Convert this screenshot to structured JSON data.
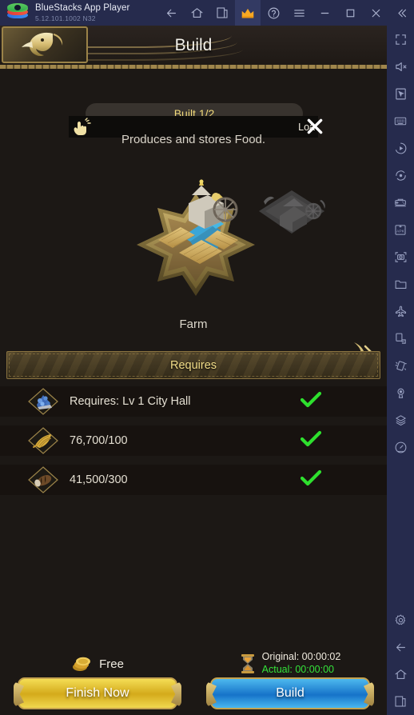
{
  "titlebar": {
    "app_name": "BlueStacks App Player",
    "version": "5.12.101.1002  N32",
    "buttons": [
      {
        "name": "back",
        "icon": "back-arrow-icon"
      },
      {
        "name": "home",
        "icon": "home-icon"
      },
      {
        "name": "multi-instance",
        "icon": "copy-icon"
      },
      {
        "name": "premium",
        "icon": "crown-icon"
      },
      {
        "name": "help",
        "icon": "question-circle-icon"
      },
      {
        "name": "menu",
        "icon": "hamburger-icon"
      },
      {
        "name": "minimize",
        "icon": "minimize-icon"
      },
      {
        "name": "maximize",
        "icon": "maximize-icon"
      },
      {
        "name": "close",
        "icon": "close-icon"
      },
      {
        "name": "collapse",
        "icon": "double-chevron-left-icon"
      }
    ]
  },
  "sidebar": {
    "items": [
      {
        "name": "fullscreen",
        "icon": "fullscreen-icon"
      },
      {
        "name": "mute",
        "icon": "speaker-mute-icon"
      },
      {
        "name": "cursor-lock",
        "icon": "cursor-icon"
      },
      {
        "name": "keyboard-controls",
        "icon": "keyboard-icon"
      },
      {
        "name": "macro-play",
        "icon": "play-circle-icon"
      },
      {
        "name": "sync-operations",
        "icon": "sync-circle-icon"
      },
      {
        "name": "game-controls",
        "icon": "gamepad-icon"
      },
      {
        "name": "install-apk",
        "icon": "apk-icon"
      },
      {
        "name": "screenshot",
        "icon": "camera-icon"
      },
      {
        "name": "media-manager",
        "icon": "folder-icon"
      },
      {
        "name": "eco-mode",
        "icon": "airplane-icon"
      },
      {
        "name": "rotate",
        "icon": "rotate-screen-icon"
      },
      {
        "name": "shake",
        "icon": "shake-icon"
      },
      {
        "name": "location",
        "icon": "location-pin-icon"
      },
      {
        "name": "layers",
        "icon": "layers-icon"
      },
      {
        "name": "performance",
        "icon": "speedometer-icon"
      },
      {
        "name": "settings",
        "icon": "gear-icon"
      },
      {
        "name": "android-back",
        "icon": "back-arrow-icon"
      },
      {
        "name": "android-home",
        "icon": "home-icon"
      },
      {
        "name": "android-recents",
        "icon": "recents-icon"
      }
    ]
  },
  "game": {
    "header_title": "Build",
    "crest_icon": "eagle-head-emblem",
    "built_counter": "Built 1/2",
    "loading_label": "Loa",
    "tap_icon": "tap-hand-icon",
    "close_label": "✕",
    "description": "Produces and stores Food.",
    "building_name": "Farm",
    "next_arrow_icon": "double-chevron-right-icon",
    "requires_header": "Requires",
    "requirements": [
      {
        "icon": "city-hall-icon",
        "label": "Requires: Lv 1 City Hall",
        "status_icon": "check-icon",
        "met": true
      },
      {
        "icon": "wheat-icon",
        "label": "76,700/100",
        "status_icon": "check-icon",
        "met": true
      },
      {
        "icon": "wood-icon",
        "label": "41,500/300",
        "status_icon": "check-icon",
        "met": true
      }
    ],
    "footer": {
      "cost_icon": "gold-coins-icon",
      "cost_label": "Free",
      "finish_button": "Finish Now",
      "timer_icon": "hourglass-icon",
      "time_original": "Original: 00:00:02",
      "time_actual": "Actual: 00:00:00",
      "build_button": "Build"
    }
  },
  "colors": {
    "titlebar_bg": "#262b4d",
    "game_bg": "#1c1815",
    "gold_text": "#f2dd88",
    "green_status": "#34e43a",
    "accent_gold": "#c5a24f",
    "accent_blue": "#1673c9"
  }
}
